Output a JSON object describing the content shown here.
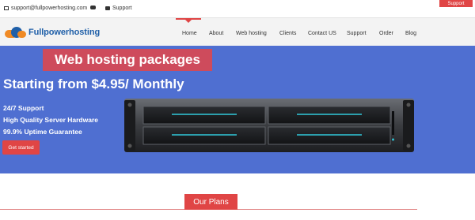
{
  "topbar": {
    "email": "support@fullpowerhosting.com",
    "support_link": "Support",
    "support_button": "Support"
  },
  "header": {
    "logo_text": "Fullpowerhosting",
    "nav": [
      "Home",
      "About",
      "Web hosting",
      "Clients",
      "Contact US",
      "Support",
      "Order",
      "Blog"
    ],
    "active_nav": "Home"
  },
  "hero": {
    "title": "Web hosting packages",
    "price": "Starting from $4.95/ Monthly",
    "features": [
      "24/7 Support",
      "High Quality Server Hardware",
      "99.9% Uptime Guarantee"
    ],
    "cta": "Get started"
  },
  "plans": {
    "heading": "Our Plans"
  },
  "colors": {
    "accent": "#e04545",
    "hero_bg": "#4f6fd1",
    "title_bg": "#ce4b5c",
    "brand_blue": "#1f5fa8",
    "brand_orange": "#f08a24"
  },
  "icons": [
    "envelope-icon",
    "chat-icon",
    "phone-icon",
    "logo-icon"
  ]
}
